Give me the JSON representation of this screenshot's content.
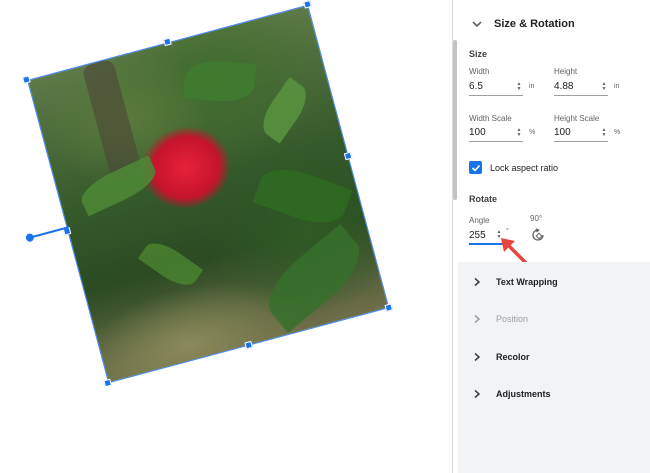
{
  "panel": {
    "header": "Size & Rotation",
    "size_title": "Size",
    "width_label": "Width",
    "width_value": "6.5",
    "width_unit": "in",
    "height_label": "Height",
    "height_value": "4.88",
    "height_unit": "in",
    "width_scale_label": "Width Scale",
    "width_scale_value": "100",
    "width_scale_unit": "%",
    "height_scale_label": "Height Scale",
    "height_scale_value": "100",
    "height_scale_unit": "%",
    "lock_label": "Lock aspect ratio",
    "rotate_title": "Rotate",
    "angle_label": "Angle",
    "angle_value": "255",
    "angle_unit": "°",
    "rotate_90_label": "90°",
    "sections": [
      {
        "label": "Text Wrapping",
        "disabled": false
      },
      {
        "label": "Position",
        "disabled": true
      },
      {
        "label": "Recolor",
        "disabled": false
      },
      {
        "label": "Adjustments",
        "disabled": false
      }
    ]
  },
  "colors": {
    "accent": "#1a73e8",
    "arrow": "#e8453c"
  }
}
